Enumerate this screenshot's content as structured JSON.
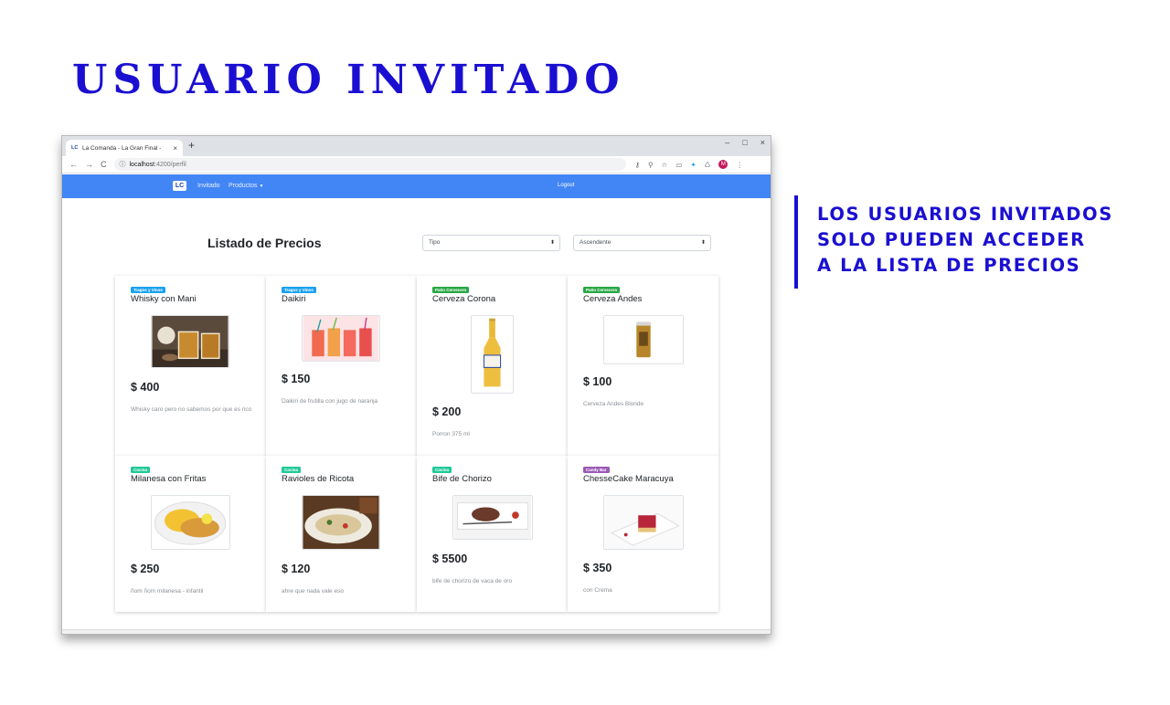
{
  "slide": {
    "title": "USUARIO INVITADO",
    "callout": [
      "LOS USUARIOS INVITADOS",
      "SOLO PUEDEN ACCEDER",
      "A LA LISTA DE PRECIOS"
    ]
  },
  "browser": {
    "tab_favicon": "LC",
    "tab_title": "La Comanda - La Gran Final -",
    "tab_close": "×",
    "new_tab": "+",
    "window_controls": {
      "minimize": "–",
      "maximize": "□",
      "close": "×"
    },
    "nav": {
      "back": "←",
      "forward": "→",
      "reload": "C"
    },
    "url_info_icon": "ⓘ",
    "url_host": "localhost",
    "url_path": ":4200/perfil",
    "profile_initial": "M"
  },
  "app": {
    "brand": "LC",
    "nav_invitado": "Invitado",
    "nav_productos": "Productos",
    "logout": "Logout",
    "heading": "Listado de Precios",
    "filter_tipo": "Tipo",
    "filter_orden": "Ascendente"
  },
  "colors": {
    "title_blue": "#1a0fd1",
    "navbar": "#4285f4",
    "badge_tragos": "#1aa1f0",
    "badge_patio": "#28a745",
    "badge_cocina": "#20c997",
    "badge_candy": "#9b59b6"
  },
  "products": [
    {
      "category": "Tragos y Vinos",
      "name": "Whisky con Mani",
      "price": "$ 400",
      "description": "Whisky caro pero no sabemos por que es rico"
    },
    {
      "category": "Tragos y Vinos",
      "name": "Daikiri",
      "price": "$ 150",
      "description": "Daikiri de frutilla con jugo de naranja"
    },
    {
      "category": "Patio Cervecero",
      "name": "Cerveza Corona",
      "price": "$ 200",
      "description": "Porron 375 ml"
    },
    {
      "category": "Patio Cervecero",
      "name": "Cerveza Andes",
      "price": "$ 100",
      "description": "Cerveza Andes Blonde"
    },
    {
      "category": "Cocina",
      "name": "Milanesa con Fritas",
      "price": "$ 250",
      "description": "ñom ñom milanesa - infantil"
    },
    {
      "category": "Cocina",
      "name": "Ravioles de Ricota",
      "price": "$ 120",
      "description": "ahre que nada vale eso"
    },
    {
      "category": "Cocina",
      "name": "Bife de Chorizo",
      "price": "$ 5500",
      "description": "bife de chorizo de vaca de oro"
    },
    {
      "category": "Candy Bar",
      "name": "ChesseCake Maracuya",
      "price": "$ 350",
      "description": "con Crema"
    }
  ]
}
